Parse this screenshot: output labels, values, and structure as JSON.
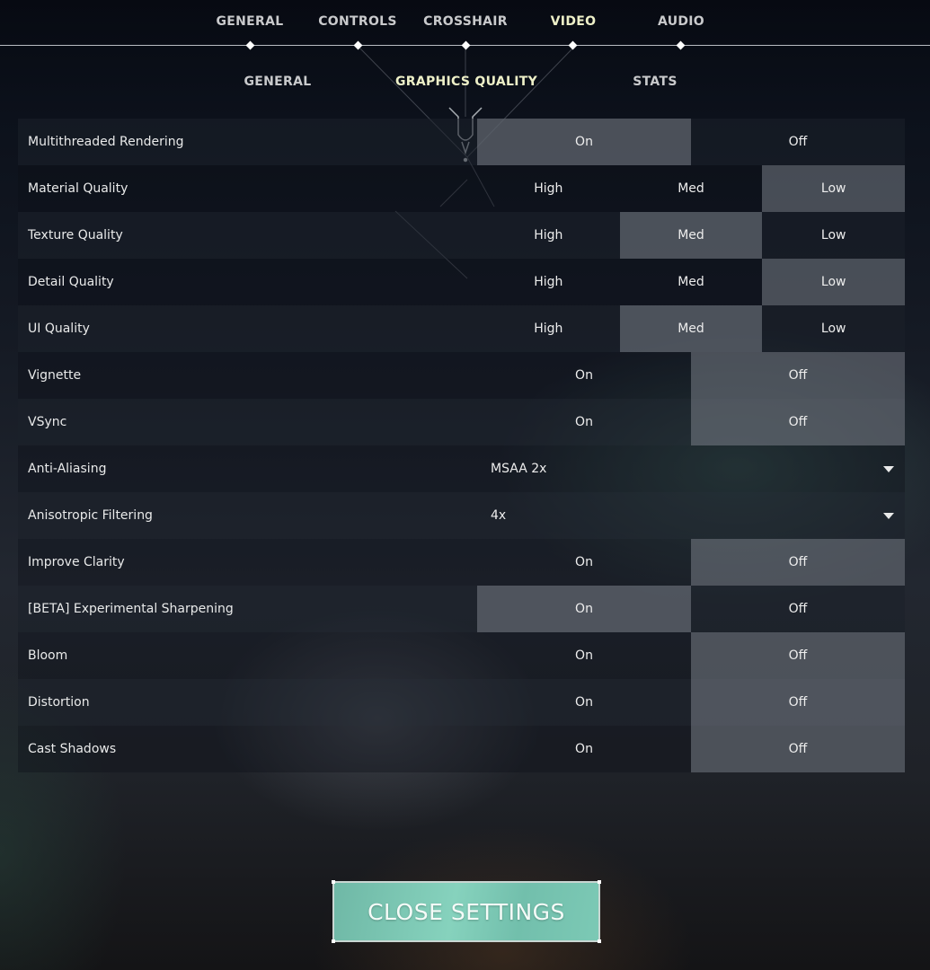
{
  "top_nav": {
    "items": [
      {
        "label": "GENERAL",
        "active": false
      },
      {
        "label": "CONTROLS",
        "active": false
      },
      {
        "label": "CROSSHAIR",
        "active": false
      },
      {
        "label": "VIDEO",
        "active": true
      },
      {
        "label": "AUDIO",
        "active": false
      }
    ]
  },
  "sub_nav": {
    "items": [
      {
        "label": "GENERAL",
        "active": false
      },
      {
        "label": "GRAPHICS QUALITY",
        "active": true
      },
      {
        "label": "STATS",
        "active": false
      }
    ]
  },
  "settings": [
    {
      "label": "Multithreaded Rendering",
      "type": "toggle",
      "options": [
        "On",
        "Off"
      ],
      "selected": "On"
    },
    {
      "label": "Material Quality",
      "type": "toggle",
      "options": [
        "High",
        "Med",
        "Low"
      ],
      "selected": "Low"
    },
    {
      "label": "Texture Quality",
      "type": "toggle",
      "options": [
        "High",
        "Med",
        "Low"
      ],
      "selected": "Med"
    },
    {
      "label": "Detail Quality",
      "type": "toggle",
      "options": [
        "High",
        "Med",
        "Low"
      ],
      "selected": "Low"
    },
    {
      "label": "UI Quality",
      "type": "toggle",
      "options": [
        "High",
        "Med",
        "Low"
      ],
      "selected": "Med"
    },
    {
      "label": "Vignette",
      "type": "toggle",
      "options": [
        "On",
        "Off"
      ],
      "selected": "Off"
    },
    {
      "label": "VSync",
      "type": "toggle",
      "options": [
        "On",
        "Off"
      ],
      "selected": "Off"
    },
    {
      "label": "Anti-Aliasing",
      "type": "dropdown",
      "value": "MSAA 2x"
    },
    {
      "label": "Anisotropic Filtering",
      "type": "dropdown",
      "value": "4x"
    },
    {
      "label": "Improve Clarity",
      "type": "toggle",
      "options": [
        "On",
        "Off"
      ],
      "selected": "Off"
    },
    {
      "label": "[BETA] Experimental Sharpening",
      "type": "toggle",
      "options": [
        "On",
        "Off"
      ],
      "selected": "On"
    },
    {
      "label": "Bloom",
      "type": "toggle",
      "options": [
        "On",
        "Off"
      ],
      "selected": "Off"
    },
    {
      "label": "Distortion",
      "type": "toggle",
      "options": [
        "On",
        "Off"
      ],
      "selected": "Off"
    },
    {
      "label": "Cast Shadows",
      "type": "toggle",
      "options": [
        "On",
        "Off"
      ],
      "selected": "Off"
    }
  ],
  "icons": {
    "dropdown": "caret-down-icon",
    "nav_marker": "diamond-icon",
    "emblem": "valorant-emblem-icon"
  },
  "close_button": {
    "label": "CLOSE SETTINGS"
  },
  "colors": {
    "accent_active_text": "#eef0c8",
    "close_button_bg": "#7cc9b5",
    "selected_option_bg": "#6f757d"
  }
}
